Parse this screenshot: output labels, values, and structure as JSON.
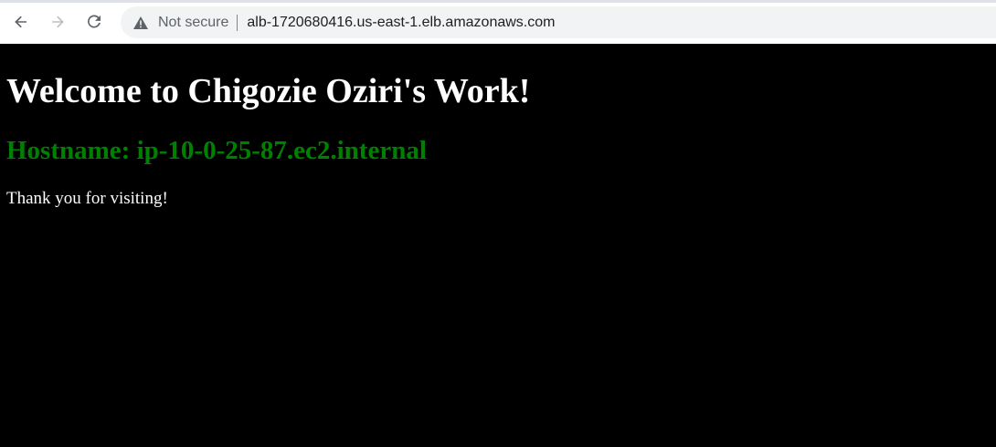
{
  "browser": {
    "security_label": "Not secure",
    "url": "alb-1720680416.us-east-1.elb.amazonaws.com",
    "icons": {
      "back": "back-arrow-icon",
      "forward": "forward-arrow-icon",
      "reload": "reload-icon",
      "security": "warning-triangle-icon"
    }
  },
  "page": {
    "heading": "Welcome to Chigozie Oziri's Work!",
    "hostname": "Hostname: ip-10-0-25-87.ec2.internal",
    "message": "Thank you for visiting!",
    "colors": {
      "background": "#000000",
      "heading": "#ffffff",
      "hostname": "#008000",
      "message": "#ffffff"
    }
  }
}
